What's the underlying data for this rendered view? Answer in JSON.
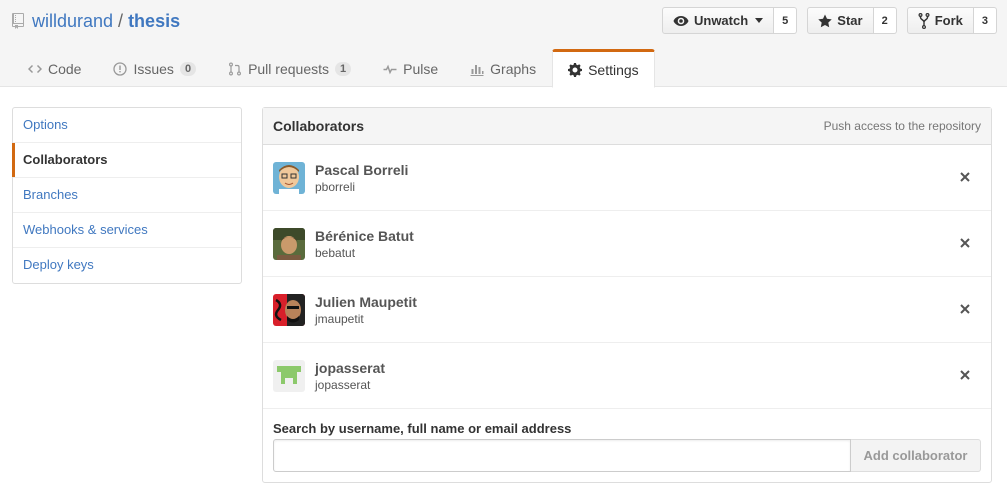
{
  "repo": {
    "owner": "willdurand",
    "separator": "/",
    "name": "thesis"
  },
  "actions": [
    {
      "label": "Unwatch",
      "count": "5"
    },
    {
      "label": "Star",
      "count": "2"
    },
    {
      "label": "Fork",
      "count": "3"
    }
  ],
  "tabs": [
    {
      "label": "Code"
    },
    {
      "label": "Issues",
      "counter": "0"
    },
    {
      "label": "Pull requests",
      "counter": "1"
    },
    {
      "label": "Pulse"
    },
    {
      "label": "Graphs"
    },
    {
      "label": "Settings",
      "selected": true
    }
  ],
  "menu": [
    {
      "label": "Options"
    },
    {
      "label": "Collaborators",
      "selected": true
    },
    {
      "label": "Branches"
    },
    {
      "label": "Webhooks & services"
    },
    {
      "label": "Deploy keys"
    }
  ],
  "collaborators_box": {
    "title": "Collaborators",
    "note": "Push access to the repository",
    "people": [
      {
        "name": "Pascal Borreli",
        "login": "pborreli"
      },
      {
        "name": "Bérénice Batut",
        "login": "bebatut"
      },
      {
        "name": "Julien Maupetit",
        "login": "jmaupetit"
      },
      {
        "name": "jopasserat",
        "login": "jopasserat"
      }
    ],
    "search_label": "Search by username, full name or email address",
    "search_placeholder": "",
    "add_button": "Add collaborator"
  },
  "colors": {
    "link": "#4078c0",
    "accent": "#d26911"
  }
}
